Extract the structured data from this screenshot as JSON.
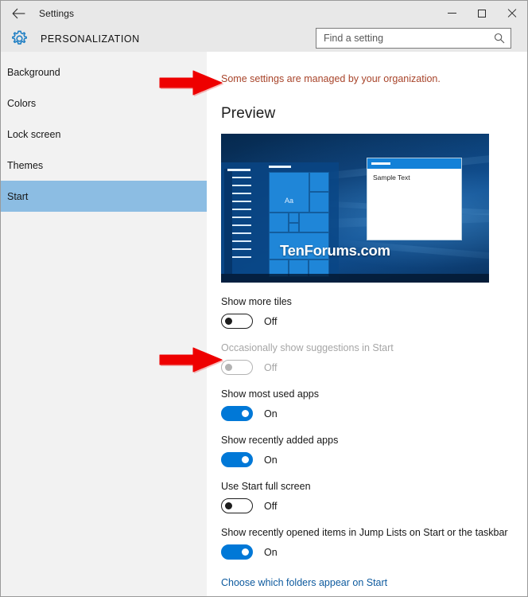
{
  "window": {
    "titlebar_title": "Settings",
    "back_icon": "back-arrow-icon",
    "minimize_label": "Minimize",
    "maximize_label": "Maximize",
    "close_label": "Close"
  },
  "header": {
    "icon": "gear-icon",
    "title": "PERSONALIZATION"
  },
  "search": {
    "placeholder": "Find a setting",
    "value": "",
    "icon": "search-icon"
  },
  "sidebar": {
    "items": [
      {
        "label": "Background",
        "selected": false
      },
      {
        "label": "Colors",
        "selected": false
      },
      {
        "label": "Lock screen",
        "selected": false
      },
      {
        "label": "Themes",
        "selected": false
      },
      {
        "label": "Start",
        "selected": true
      }
    ]
  },
  "content": {
    "org_notice": "Some settings are managed by your organization.",
    "org_notice_color": "#a8442a",
    "preview_heading": "Preview",
    "preview": {
      "sample_window_text": "Sample Text",
      "tile_text": "Aa",
      "watermark": "TenForums.com"
    },
    "settings": [
      {
        "label": "Show more tiles",
        "state": "Off",
        "on": false,
        "disabled": false
      },
      {
        "label": "Occasionally show suggestions in Start",
        "state": "Off",
        "on": false,
        "disabled": true
      },
      {
        "label": "Show most used apps",
        "state": "On",
        "on": true,
        "disabled": false
      },
      {
        "label": "Show recently added apps",
        "state": "On",
        "on": true,
        "disabled": false
      },
      {
        "label": "Use Start full screen",
        "state": "Off",
        "on": false,
        "disabled": false
      },
      {
        "label": "Show recently opened items in Jump Lists on Start or the taskbar",
        "state": "On",
        "on": true,
        "disabled": false
      }
    ],
    "folders_link": "Choose which folders appear on Start"
  },
  "annotations": {
    "color": "#ee0000",
    "arrows": [
      {
        "name": "arrow-pointing-to-org-notice",
        "target": "org-notice"
      },
      {
        "name": "arrow-pointing-to-suggestions-toggle",
        "target": "suggestions-toggle"
      }
    ]
  },
  "theme": {
    "accent": "#0078d7",
    "selection": "#8cbde3",
    "chrome": "#e8e8e8",
    "sidebar_bg": "#f2f2f2",
    "link": "#0d5a9e"
  }
}
